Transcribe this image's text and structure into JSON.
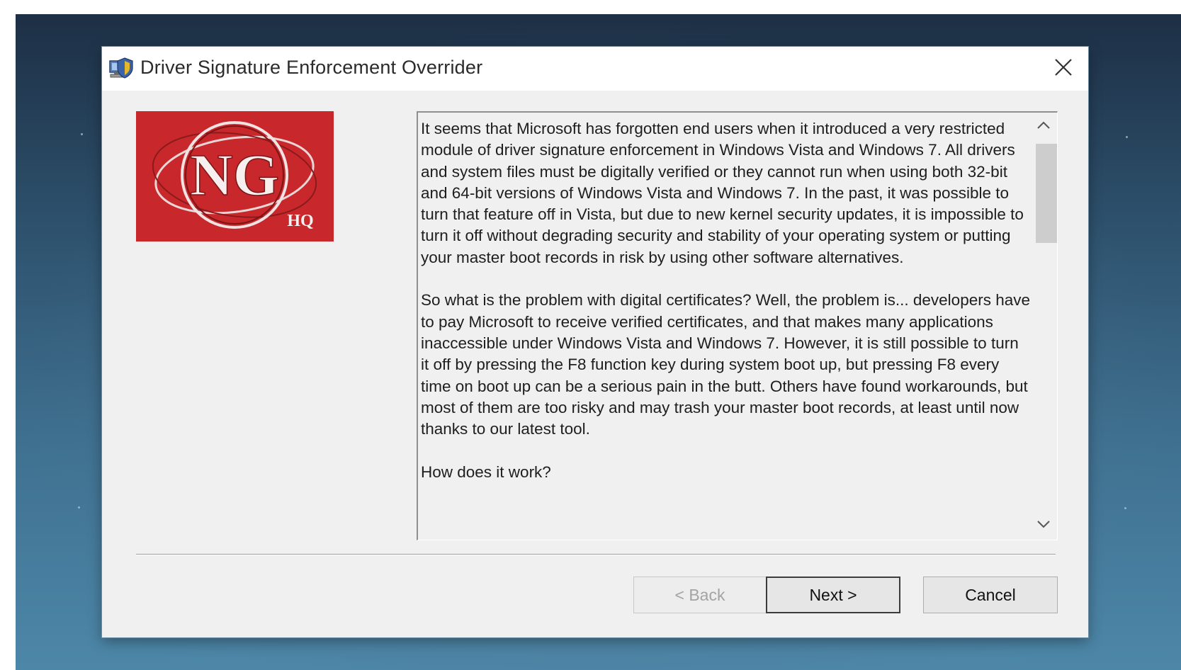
{
  "window": {
    "title": "Driver Signature Enforcement Overrider",
    "close_label": "Close"
  },
  "logo": {
    "main_text": "NG",
    "sub_text": "HQ",
    "background": "#c8282b"
  },
  "description": {
    "paragraphs": [
      "It seems that Microsoft has forgotten end users when it introduced a very restricted module of driver signature enforcement in Windows Vista and Windows 7. All drivers and system files must be digitally verified or they cannot run when using both 32-bit and 64-bit versions of Windows Vista and Windows 7. In the past, it was possible to turn that feature off in Vista, but due to new kernel security updates, it is impossible to turn it off without degrading security and stability of your operating system or putting your master boot records in risk by using other software alternatives.",
      "So what is the problem with digital certificates? Well, the problem is... developers have to pay Microsoft to receive verified certificates, and that makes many applications inaccessible under Windows Vista and Windows 7. However, it is still possible to turn it off by pressing the F8 function key during system boot up, but pressing F8 every time on boot up can be a serious pain in the butt. Others have found workarounds, but most of them are too risky and may trash your master boot records, at least until now thanks to our latest tool.",
      "How does it work?"
    ],
    "scroll_position": 0.0
  },
  "buttons": {
    "back": "< Back",
    "next": "Next >",
    "cancel": "Cancel"
  },
  "icons": {
    "app": "computer-shield-icon",
    "close": "close-icon",
    "scroll_up": "chevron-up-icon",
    "scroll_down": "chevron-down-icon"
  }
}
